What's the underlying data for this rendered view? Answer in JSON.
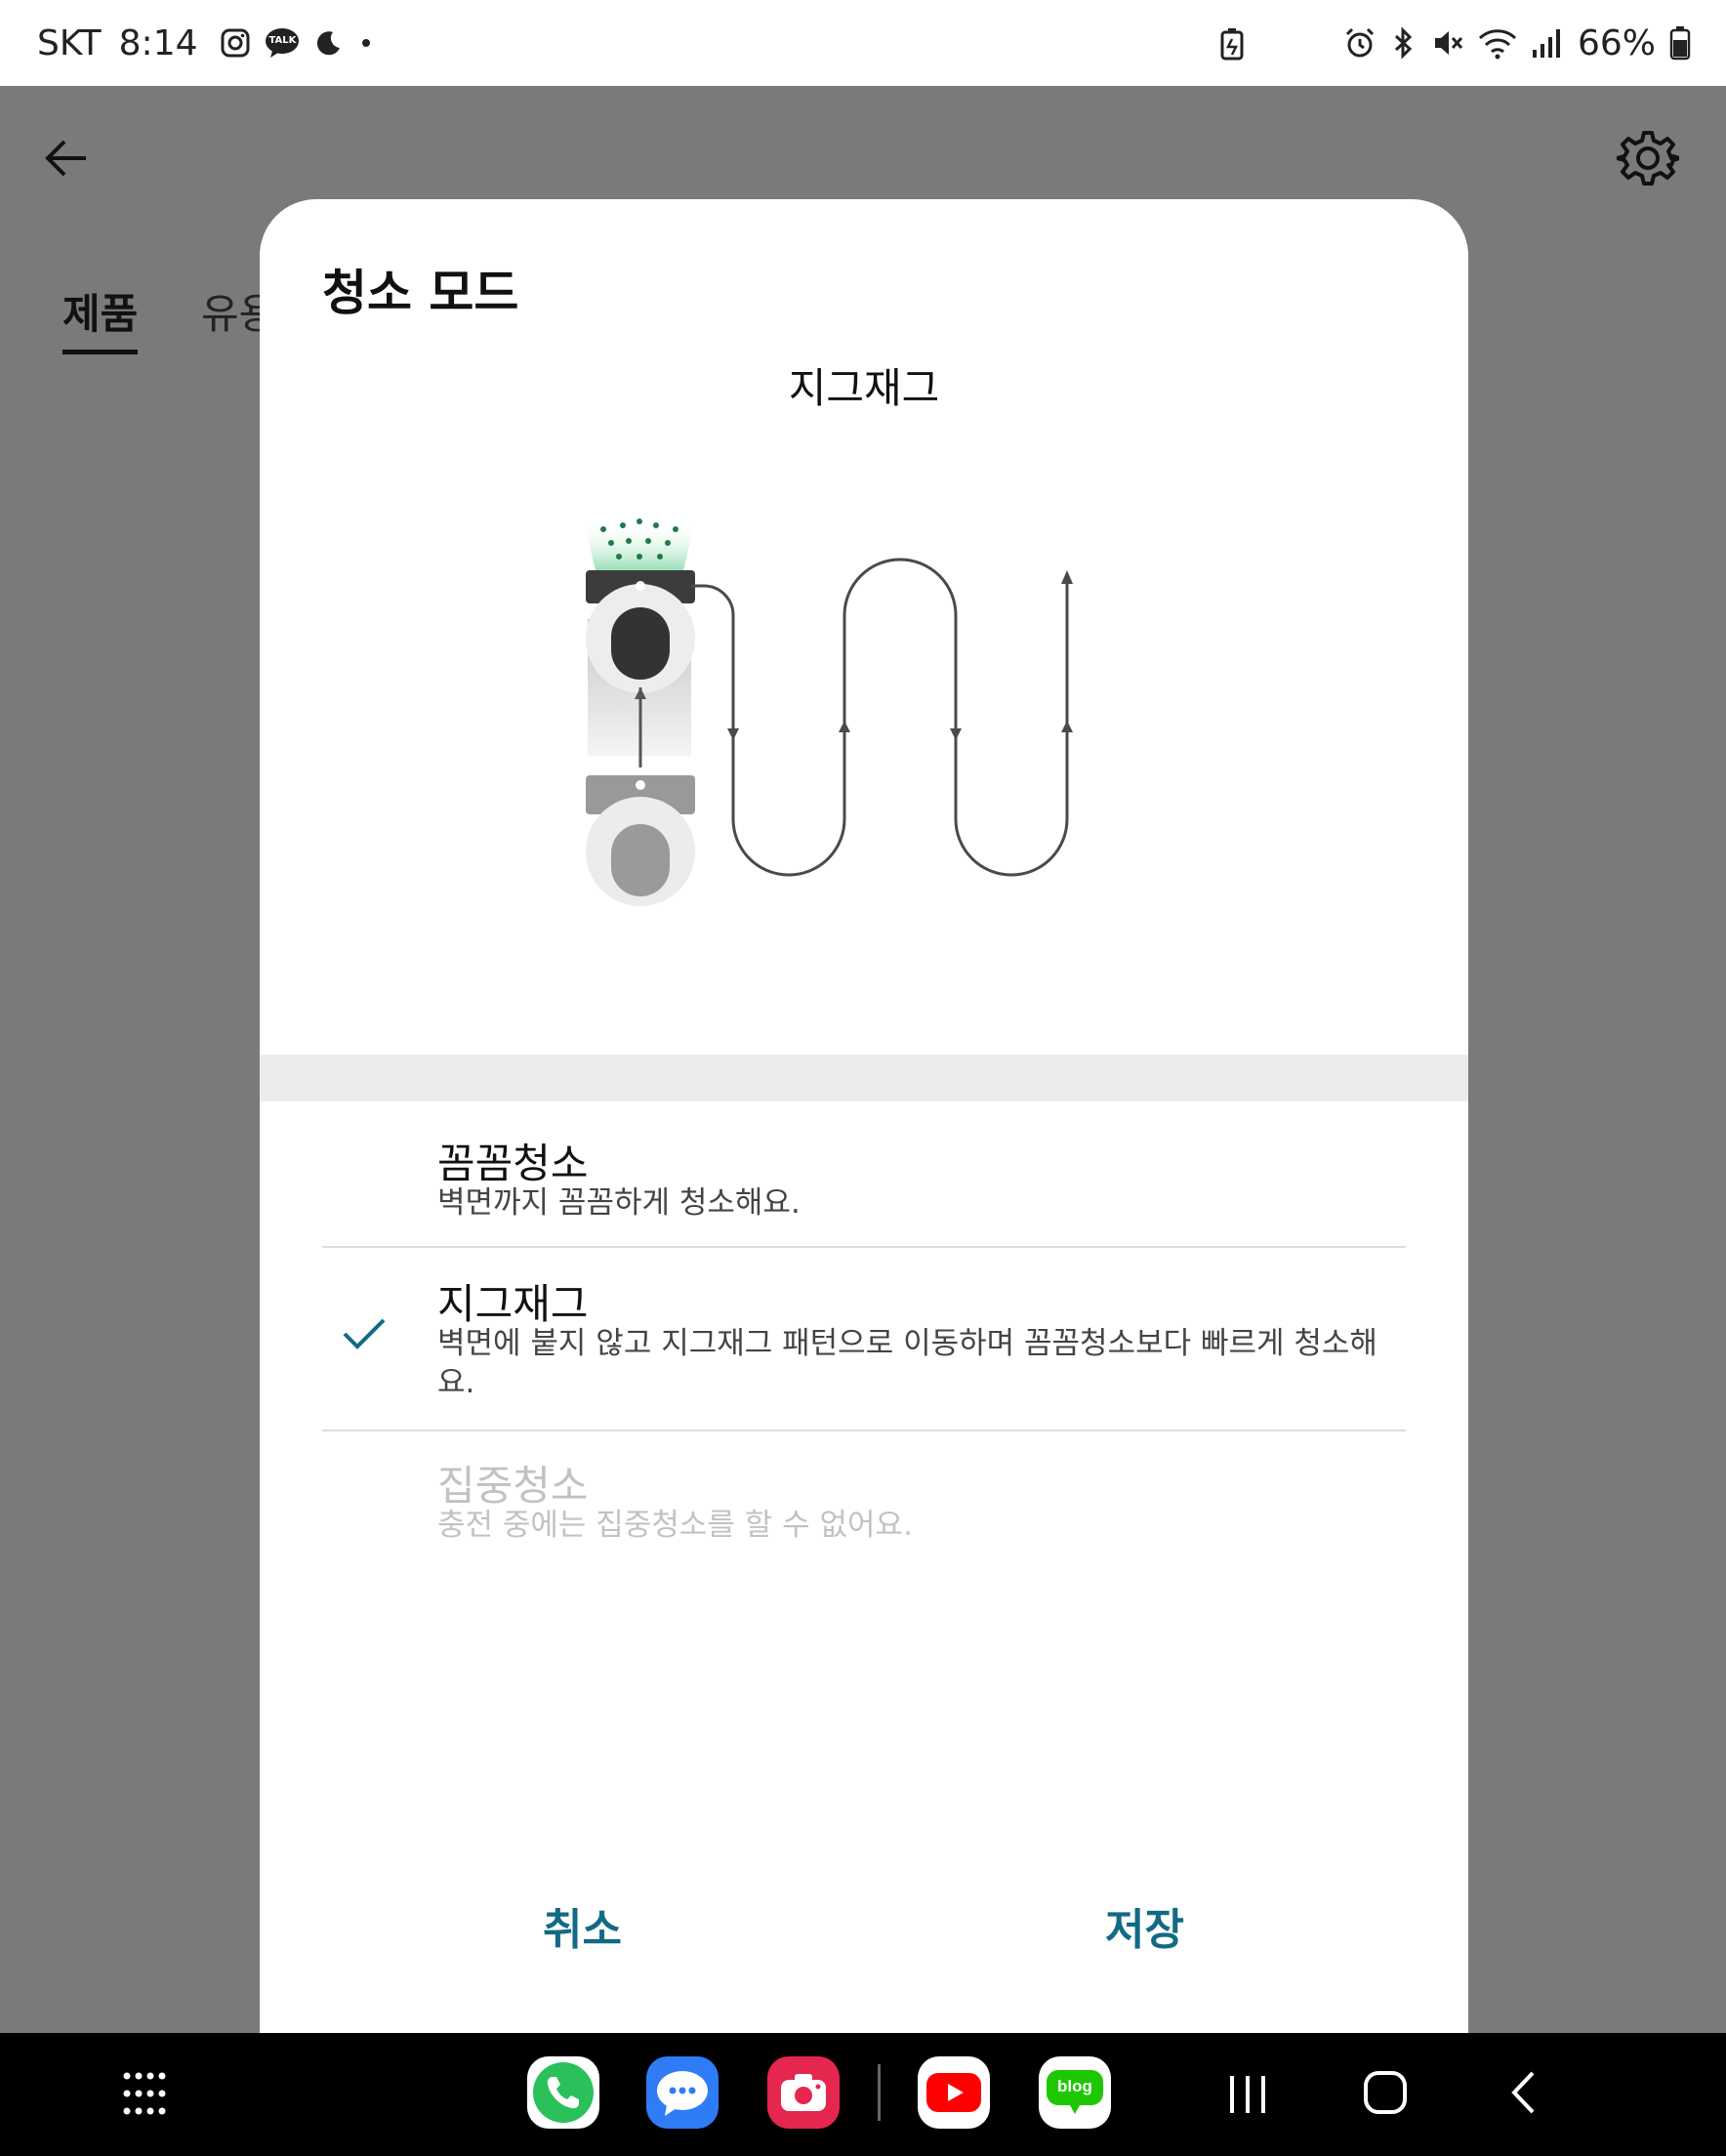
{
  "status_bar": {
    "carrier": "SKT",
    "time": "8:14",
    "kakao_badge": "TALK",
    "battery": "66%"
  },
  "app": {
    "tabs": [
      {
        "label": "제품"
      },
      {
        "label": "유용"
      }
    ]
  },
  "dialog": {
    "title": "청소 모드",
    "selected_mode_name": "지그재그",
    "options": [
      {
        "title": "꼼꼼청소",
        "description": "벽면까지 꼼꼼하게 청소해요.",
        "selected": false,
        "enabled": true
      },
      {
        "title": "지그재그",
        "description": "벽면에 붙지 않고 지그재그 패턴으로 이동하며 꼼꼼청소보다 빠르게 청소해요.",
        "selected": true,
        "enabled": true
      },
      {
        "title": "집중청소",
        "description": "충전 중에는 집중청소를 할 수 없어요.",
        "selected": false,
        "enabled": false
      }
    ],
    "cancel_label": "취소",
    "save_label": "저장"
  },
  "navbar": {
    "blog_label": "blog"
  },
  "colors": {
    "accent": "#136a86",
    "dim_overlay": "#7a7a7a",
    "phone_app": "#2bc05a",
    "messages_app": "#2f7cf6",
    "camera_app": "#e5264f",
    "youtube_app": "#ff0000",
    "blog_app": "#1ec800"
  }
}
